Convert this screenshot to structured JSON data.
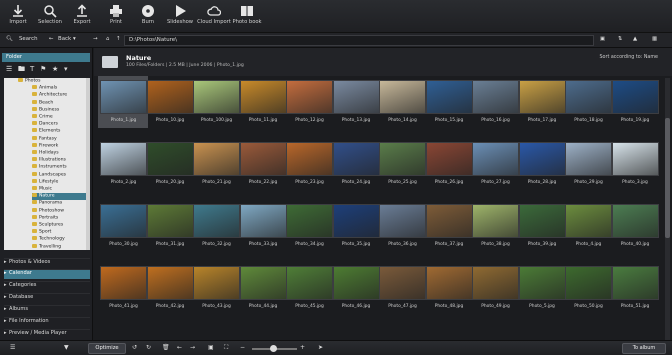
{
  "toolbar": {
    "buttons": [
      {
        "label": "Import",
        "icon": "import-icon"
      },
      {
        "label": "Selection",
        "icon": "selection-icon"
      },
      {
        "label": "Export",
        "icon": "export-icon"
      },
      {
        "label": "Print",
        "icon": "print-icon"
      },
      {
        "label": "Burn",
        "icon": "burn-icon"
      },
      {
        "label": "Slideshow",
        "icon": "slideshow-icon"
      },
      {
        "label": "Cloud Import",
        "icon": "cloud-import-icon"
      },
      {
        "label": "Photo book",
        "icon": "photo-book-icon"
      }
    ]
  },
  "nav": {
    "search_label": "Search",
    "back_label": "Back",
    "path": "D:\\Photos\\Nature\\"
  },
  "left": {
    "folder_header": "Folder",
    "tree": [
      "Photos",
      "Animals",
      "Architecture",
      "Beach",
      "Business",
      "Crime",
      "Dancers",
      "Elements",
      "Fantasy",
      "Firework",
      "Holidays",
      "Illustrations",
      "Instruments",
      "Landscapes",
      "Lifestyle",
      "Music",
      "Nature",
      "Panorama",
      "Photoshow",
      "Portraits",
      "Sculptures",
      "Sport",
      "Technology",
      "Travelling"
    ],
    "selected": "Nature",
    "sections": [
      "Photos & Videos",
      "Calendar",
      "Categories",
      "Database",
      "Albums",
      "File Information",
      "Preview / Media Player"
    ],
    "active_section": "Calendar"
  },
  "main": {
    "folder_title": "Nature",
    "meta": "100 Files/Folders | 2.5 MB | June 2006 | Photo_1.jpg",
    "sort": "Sort according to: Name",
    "captions": [
      [
        "Photo_1.jpg",
        "Photo_10.jpg",
        "Photo_100.jpg",
        "Photo_11.jpg",
        "Photo_12.jpg",
        "Photo_13.jpg",
        "Photo_14.jpg",
        "Photo_15.jpg",
        "Photo_16.jpg",
        "Photo_17.jpg",
        "Photo_18.jpg",
        "Photo_19.jpg"
      ],
      [
        "Photo_2.jpg",
        "Photo_20.jpg",
        "Photo_21.jpg",
        "Photo_22.jpg",
        "Photo_23.jpg",
        "Photo_24.jpg",
        "Photo_25.jpg",
        "Photo_26.jpg",
        "Photo_27.jpg",
        "Photo_28.jpg",
        "Photo_29.jpg",
        "Photo_3.jpg"
      ],
      [
        "Photo_30.jpg",
        "Photo_31.jpg",
        "Photo_32.jpg",
        "Photo_33.jpg",
        "Photo_34.jpg",
        "Photo_35.jpg",
        "Photo_36.jpg",
        "Photo_37.jpg",
        "Photo_38.jpg",
        "Photo_39.jpg",
        "Photo_4.jpg",
        "Photo_40.jpg"
      ],
      [
        "Photo_41.jpg",
        "Photo_42.jpg",
        "Photo_43.jpg",
        "Photo_44.jpg",
        "Photo_45.jpg",
        "Photo_46.jpg",
        "Photo_47.jpg",
        "Photo_48.jpg",
        "Photo_49.jpg",
        "Photo_5.jpg",
        "Photo_50.jpg",
        "Photo_51.jpg"
      ]
    ],
    "palette": [
      [
        "#6f93b3",
        "#b0621d",
        "#a9c77a",
        "#c88a2a",
        "#c46d3e",
        "#7a8aa0",
        "#c7b89a",
        "#2f5f95",
        "#6a7f95",
        "#c9a045",
        "#4d6c8d",
        "#1d4c86"
      ],
      [
        "#bfd2e2",
        "#2f4d2a",
        "#c99250",
        "#9a5a3a",
        "#b9672a",
        "#314f8a",
        "#5a7d4a",
        "#8a4634",
        "#6b8fb6",
        "#2a58a8",
        "#9db1c7",
        "#d7e3ea"
      ],
      [
        "#3a6f95",
        "#5d7a36",
        "#3f7a8d",
        "#7fa8c3",
        "#3e6b35",
        "#1d3f7a",
        "#6a7d96",
        "#7e5c38",
        "#9eb46a",
        "#3b6a3a",
        "#6c8d3e",
        "#4c7d52"
      ],
      [
        "#c06a1e",
        "#bf6f1f",
        "#b8842a",
        "#5f8a3a",
        "#4f7e37",
        "#4d7c32",
        "#7a5a3a",
        "#a06a32",
        "#8f6a32",
        "#4b7b36",
        "#3d6a2e",
        "#4a7c3f"
      ]
    ],
    "selected_photo": "Photo_1.jpg"
  },
  "bottom": {
    "optimize_label": "Optimize",
    "album_label": "To album"
  }
}
